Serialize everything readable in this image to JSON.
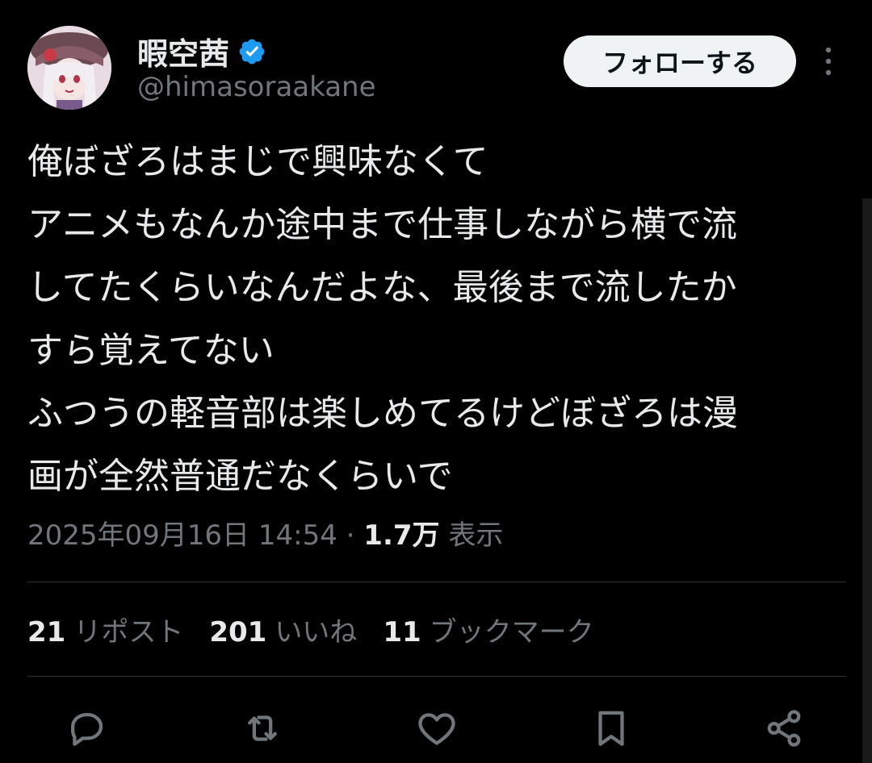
{
  "author": {
    "display_name": "暇空茜",
    "handle": "@himasoraakane",
    "verified_color": "#1d9bf0"
  },
  "follow_button": {
    "label": "フォローする"
  },
  "tweet": {
    "lines": [
      "俺ぼざろはまじで興味なくて",
      "アニメもなんか途中まで仕事しながら横で流",
      "してたくらいなんだよな、最後まで流したか",
      "すら覚えてない",
      "ふつうの軽音部は楽しめてるけどぼざろは漫",
      "画が全然普通だなくらいで"
    ]
  },
  "meta": {
    "timestamp": "2025年09月16日 14:54",
    "separator": " · ",
    "views_count": "1.7万",
    "views_label": " 表示"
  },
  "stats": {
    "reposts": {
      "count": "21",
      "label": "リポスト"
    },
    "likes": {
      "count": "201",
      "label": "いいね"
    },
    "bookmarks": {
      "count": "11",
      "label": "ブックマーク"
    }
  },
  "actions": [
    "reply-icon",
    "retweet-icon",
    "like-icon",
    "bookmark-icon",
    "share-icon"
  ],
  "colors": {
    "background": "#000000",
    "text": "#e7e9ea",
    "secondary_text": "#71767b",
    "divider": "#2f3336",
    "follow_bg": "#eff3f4",
    "verified": "#1d9bf0"
  }
}
